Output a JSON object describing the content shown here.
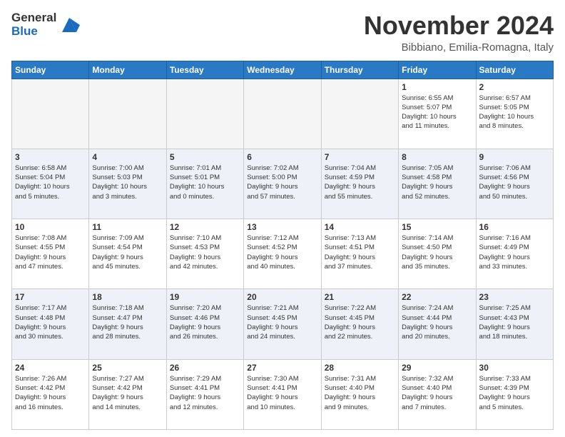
{
  "header": {
    "title": "November 2024",
    "location": "Bibbiano, Emilia-Romagna, Italy"
  },
  "days": [
    "Sunday",
    "Monday",
    "Tuesday",
    "Wednesday",
    "Thursday",
    "Friday",
    "Saturday"
  ],
  "weeks": [
    [
      {
        "day": "",
        "info": ""
      },
      {
        "day": "",
        "info": ""
      },
      {
        "day": "",
        "info": ""
      },
      {
        "day": "",
        "info": ""
      },
      {
        "day": "",
        "info": ""
      },
      {
        "day": "1",
        "info": "Sunrise: 6:55 AM\nSunset: 5:07 PM\nDaylight: 10 hours\nand 11 minutes."
      },
      {
        "day": "2",
        "info": "Sunrise: 6:57 AM\nSunset: 5:05 PM\nDaylight: 10 hours\nand 8 minutes."
      }
    ],
    [
      {
        "day": "3",
        "info": "Sunrise: 6:58 AM\nSunset: 5:04 PM\nDaylight: 10 hours\nand 5 minutes."
      },
      {
        "day": "4",
        "info": "Sunrise: 7:00 AM\nSunset: 5:03 PM\nDaylight: 10 hours\nand 3 minutes."
      },
      {
        "day": "5",
        "info": "Sunrise: 7:01 AM\nSunset: 5:01 PM\nDaylight: 10 hours\nand 0 minutes."
      },
      {
        "day": "6",
        "info": "Sunrise: 7:02 AM\nSunset: 5:00 PM\nDaylight: 9 hours\nand 57 minutes."
      },
      {
        "day": "7",
        "info": "Sunrise: 7:04 AM\nSunset: 4:59 PM\nDaylight: 9 hours\nand 55 minutes."
      },
      {
        "day": "8",
        "info": "Sunrise: 7:05 AM\nSunset: 4:58 PM\nDaylight: 9 hours\nand 52 minutes."
      },
      {
        "day": "9",
        "info": "Sunrise: 7:06 AM\nSunset: 4:56 PM\nDaylight: 9 hours\nand 50 minutes."
      }
    ],
    [
      {
        "day": "10",
        "info": "Sunrise: 7:08 AM\nSunset: 4:55 PM\nDaylight: 9 hours\nand 47 minutes."
      },
      {
        "day": "11",
        "info": "Sunrise: 7:09 AM\nSunset: 4:54 PM\nDaylight: 9 hours\nand 45 minutes."
      },
      {
        "day": "12",
        "info": "Sunrise: 7:10 AM\nSunset: 4:53 PM\nDaylight: 9 hours\nand 42 minutes."
      },
      {
        "day": "13",
        "info": "Sunrise: 7:12 AM\nSunset: 4:52 PM\nDaylight: 9 hours\nand 40 minutes."
      },
      {
        "day": "14",
        "info": "Sunrise: 7:13 AM\nSunset: 4:51 PM\nDaylight: 9 hours\nand 37 minutes."
      },
      {
        "day": "15",
        "info": "Sunrise: 7:14 AM\nSunset: 4:50 PM\nDaylight: 9 hours\nand 35 minutes."
      },
      {
        "day": "16",
        "info": "Sunrise: 7:16 AM\nSunset: 4:49 PM\nDaylight: 9 hours\nand 33 minutes."
      }
    ],
    [
      {
        "day": "17",
        "info": "Sunrise: 7:17 AM\nSunset: 4:48 PM\nDaylight: 9 hours\nand 30 minutes."
      },
      {
        "day": "18",
        "info": "Sunrise: 7:18 AM\nSunset: 4:47 PM\nDaylight: 9 hours\nand 28 minutes."
      },
      {
        "day": "19",
        "info": "Sunrise: 7:20 AM\nSunset: 4:46 PM\nDaylight: 9 hours\nand 26 minutes."
      },
      {
        "day": "20",
        "info": "Sunrise: 7:21 AM\nSunset: 4:45 PM\nDaylight: 9 hours\nand 24 minutes."
      },
      {
        "day": "21",
        "info": "Sunrise: 7:22 AM\nSunset: 4:45 PM\nDaylight: 9 hours\nand 22 minutes."
      },
      {
        "day": "22",
        "info": "Sunrise: 7:24 AM\nSunset: 4:44 PM\nDaylight: 9 hours\nand 20 minutes."
      },
      {
        "day": "23",
        "info": "Sunrise: 7:25 AM\nSunset: 4:43 PM\nDaylight: 9 hours\nand 18 minutes."
      }
    ],
    [
      {
        "day": "24",
        "info": "Sunrise: 7:26 AM\nSunset: 4:42 PM\nDaylight: 9 hours\nand 16 minutes."
      },
      {
        "day": "25",
        "info": "Sunrise: 7:27 AM\nSunset: 4:42 PM\nDaylight: 9 hours\nand 14 minutes."
      },
      {
        "day": "26",
        "info": "Sunrise: 7:29 AM\nSunset: 4:41 PM\nDaylight: 9 hours\nand 12 minutes."
      },
      {
        "day": "27",
        "info": "Sunrise: 7:30 AM\nSunset: 4:41 PM\nDaylight: 9 hours\nand 10 minutes."
      },
      {
        "day": "28",
        "info": "Sunrise: 7:31 AM\nSunset: 4:40 PM\nDaylight: 9 hours\nand 9 minutes."
      },
      {
        "day": "29",
        "info": "Sunrise: 7:32 AM\nSunset: 4:40 PM\nDaylight: 9 hours\nand 7 minutes."
      },
      {
        "day": "30",
        "info": "Sunrise: 7:33 AM\nSunset: 4:39 PM\nDaylight: 9 hours\nand 5 minutes."
      }
    ]
  ]
}
